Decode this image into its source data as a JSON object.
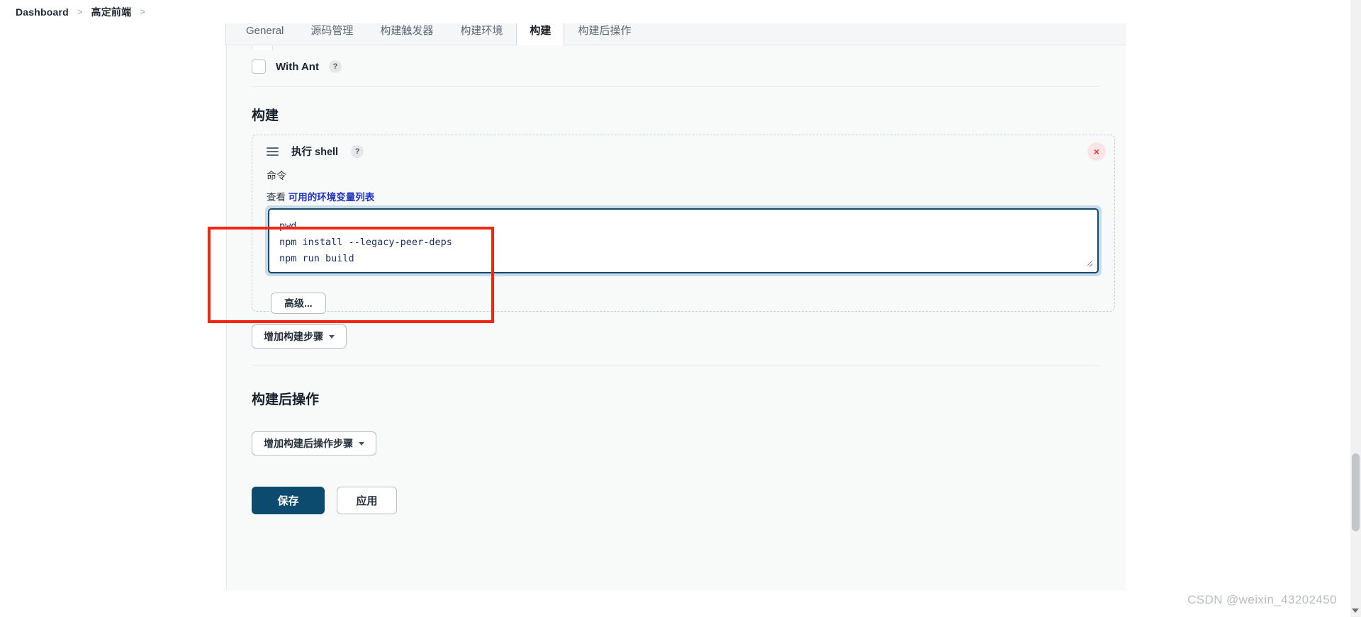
{
  "breadcrumb": {
    "items": [
      {
        "label": "Dashboard"
      },
      {
        "label": "高定前端"
      }
    ],
    "separator": ">"
  },
  "tabs": [
    {
      "label": "General",
      "active": false
    },
    {
      "label": "源码管理",
      "active": false
    },
    {
      "label": "构建触发器",
      "active": false
    },
    {
      "label": "构建环境",
      "active": false
    },
    {
      "label": "构建",
      "active": true
    },
    {
      "label": "构建后操作",
      "active": false
    }
  ],
  "with_ant": {
    "label": "With Ant",
    "help": "?",
    "checked": false
  },
  "build_section": {
    "title": "构建",
    "builder": {
      "title": "执行 shell",
      "help": "?",
      "delete_icon": "×",
      "command_label": "命令",
      "env_prefix": "查看",
      "env_link": "可用的环境变量列表",
      "command_value": "pwd\nnpm install --legacy-peer-deps\nnpm run build",
      "advanced_button": "高级..."
    },
    "add_step_button": "增加构建步骤"
  },
  "post_build_section": {
    "title": "构建后操作",
    "add_step_button": "增加构建后操作步骤"
  },
  "form_actions": {
    "save": "保存",
    "apply": "应用"
  },
  "watermark": "CSDN @weixin_43202450",
  "colors": {
    "save_button": "#0c4a6e",
    "link": "#1f33c4",
    "annotation": "#f42613",
    "code_text": "#1c2b6b",
    "textarea_border": "#12496e"
  }
}
